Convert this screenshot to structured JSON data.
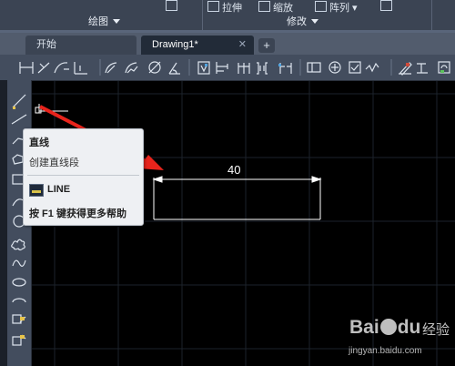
{
  "ribbon": {
    "stretch_label": "拉伸",
    "scale_label": "缩放",
    "array_label": "阵列",
    "draw_panel": "绘图",
    "modify_panel": "修改"
  },
  "tabs": [
    {
      "label": "开始"
    },
    {
      "label": "Drawing1*",
      "close": "✕"
    }
  ],
  "tab_add": "+",
  "tooltip": {
    "title": "直线",
    "description": "创建直线段",
    "command": "LINE",
    "help": "按 F1 键获得更多帮助"
  },
  "dimension": {
    "value": "40"
  },
  "colors": {
    "annotation_arrow": "#e8241c",
    "dimension": "#ffffff",
    "ribbon_bg": "#3b4453",
    "toolbar_bg": "#434d5e"
  },
  "toolbar_icons": [
    "linear-dimension-icon",
    "aligned-dimension-icon",
    "arc-length-icon",
    "ordinate-dimension-icon",
    "radius-dimension-icon",
    "jogged-icon",
    "diameter-icon",
    "angular-icon",
    "quick-dimension-icon",
    "baseline-icon",
    "continue-icon",
    "space-icon",
    "break-icon",
    "tolerance-icon",
    "center-mark-icon",
    "inspection-icon",
    "jogged-linear-icon",
    "edit-dimension-icon",
    "edit-text-icon",
    "update-icon"
  ],
  "left_icons": [
    "line-icon",
    "construction-line-icon",
    "polyline-icon",
    "polygon-icon",
    "rectangle-icon",
    "arc-icon",
    "circle-icon",
    "revision-cloud-icon",
    "spline-icon",
    "ellipse-icon",
    "ellipse-arc-icon",
    "insert-block-icon",
    "make-block-icon"
  ],
  "watermark": {
    "brand": "Bai du",
    "suffix": "经验",
    "url": "jingyan.baidu.com"
  }
}
